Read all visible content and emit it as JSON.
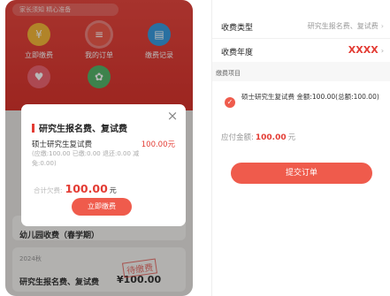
{
  "left": {
    "banner": "家长须知 精心准备",
    "menu": [
      {
        "label": "立即缴费",
        "icon": "wallet-icon",
        "glyph": "¥"
      },
      {
        "label": "我的订单",
        "icon": "order-icon",
        "glyph": "≡"
      },
      {
        "label": "缴费记录",
        "icon": "record-icon",
        "glyph": "▤"
      },
      {
        "label": "",
        "icon": "heart-icon",
        "glyph": "♥"
      },
      {
        "label": "",
        "icon": "leaf-icon",
        "glyph": "✿"
      }
    ],
    "bg_cards": [
      {
        "title": "幼儿园收费（春学期）"
      },
      {
        "subtitle": "2024秋"
      },
      {
        "title": "研究生报名费、复试费",
        "amount": "¥100.00",
        "stamp": "待缴费"
      }
    ],
    "modal": {
      "title": "研究生报名费、复试费",
      "item_name": "硕士研究生复试费",
      "item_price": "100.00元",
      "item_detail": "(应缴:100.00 已缴:0.00 退还:0.00 减免:0.00)",
      "total_label": "合计欠费:",
      "total_amount": "100.00",
      "total_unit": "元",
      "pay_button": "立即缴费"
    }
  },
  "right": {
    "rows": [
      {
        "key": "收费类型",
        "value": "研究生报名费、复试费"
      },
      {
        "key": "收费年度",
        "value": "XXXX"
      }
    ],
    "section_label": "缴费项目",
    "fee_item": "硕士研究生复试费 金额:100.00(总额:100.00)",
    "due_label": "应付金额:",
    "due_amount": "100.00",
    "due_unit": "元",
    "submit_button": "提交订单"
  }
}
